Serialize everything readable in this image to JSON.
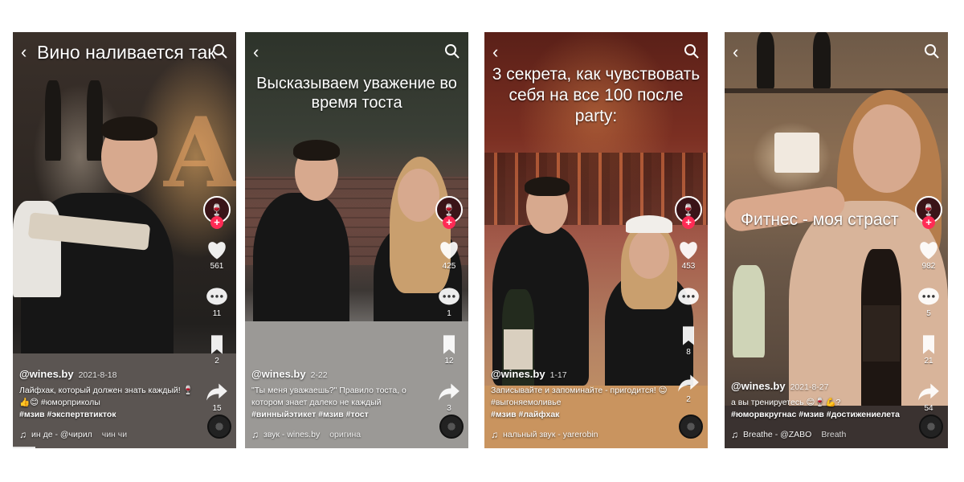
{
  "videos": [
    {
      "headline": "Вино наливается так",
      "likes": "561",
      "comments": "11",
      "saves": "2",
      "shares": "15",
      "username": "@wines.by",
      "date": "2021-8-18",
      "caption": "Лайфхак, который должен знать каждый! 🍷👍😊 #юморприколы",
      "tags": "#мзив #экспертвтикток",
      "sound_a": "ин де - @чирил",
      "sound_b": "чин чи",
      "progress": 0.1
    },
    {
      "headline": "Высказываем уважение во время тоста",
      "likes": "425",
      "comments": "1",
      "saves": "12",
      "shares": "3",
      "username": "@wines.by",
      "date": "2-22",
      "caption": "\"Ты меня уважаешь?\" Правило тоста, о котором знает далеко не каждый",
      "tags": "#винныйэтикет #мзив #тост",
      "sound_a": "звук - wines.by",
      "sound_b": "оригина",
      "progress": 0
    },
    {
      "headline": "3 секрета, как чувствовать себя на все 100 после party:",
      "likes": "453",
      "comments": "",
      "saves": "8",
      "shares": "2",
      "username": "@wines.by",
      "date": "1-17",
      "caption": "Записывайте и запоминайте - пригодится! 😉 #выгоняемоливье",
      "tags": "#мзив #лайфхак",
      "sound_a": "нальный звук - yarerobin",
      "sound_b": "",
      "progress": 0
    },
    {
      "headline": "Фитнес - моя страст",
      "likes": "982",
      "comments": "5",
      "saves": "21",
      "shares": "54",
      "username": "@wines.by",
      "date": "2021-8-27",
      "caption": "а вы тренируетесь 😊🍷💪?",
      "tags": "#юморвкругнас #мзив #достижениелета",
      "sound_a": "Breathe - @ZABO",
      "sound_b": "Breath",
      "progress": 0
    }
  ],
  "colors": {
    "like_pink": "#ff2b55",
    "text": "#ffffff"
  },
  "icons": [
    "back-arrow-icon",
    "search-icon",
    "heart-icon",
    "comment-icon",
    "bookmark-icon",
    "share-icon",
    "music-note-icon"
  ]
}
